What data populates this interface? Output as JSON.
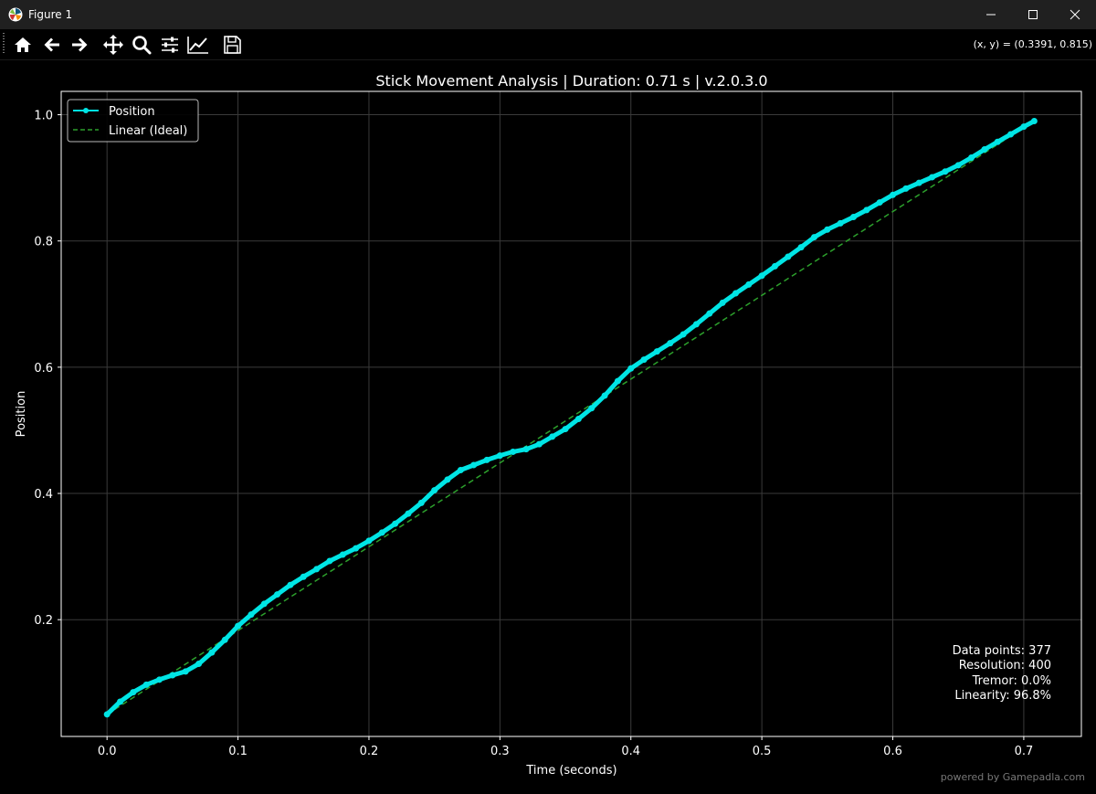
{
  "window": {
    "title": "Figure 1"
  },
  "toolbar": {
    "coords": "(x, y) = (0.3391, 0.815)",
    "tools": [
      "home-icon",
      "back-arrow-icon",
      "forward-arrow-icon",
      "pan-icon",
      "zoom-icon",
      "configure-subplots-icon",
      "edit-axis-icon",
      "save-icon"
    ]
  },
  "colors": {
    "background": "#000000",
    "series": "#00e5e5",
    "ideal": "#2ca02c",
    "grid": "#3a3a3a"
  },
  "stats": [
    "Data points: 377",
    "Resolution: 400",
    "Tremor: 0.0%",
    "Linearity: 96.8%"
  ],
  "watermark": "powered by Gamepadla.com",
  "chart_data": {
    "type": "line",
    "title": "Stick Movement Analysis | Duration: 0.71 s | v.2.0.3.0",
    "xlabel": "Time (seconds)",
    "ylabel": "Position",
    "xlim": [
      -0.035,
      0.744
    ],
    "ylim": [
      0.015,
      1.037
    ],
    "xticks": [
      0.0,
      0.1,
      0.2,
      0.3,
      0.4,
      0.5,
      0.6,
      0.7
    ],
    "xtick_labels": [
      "0.0",
      "0.1",
      "0.2",
      "0.3",
      "0.4",
      "0.5",
      "0.6",
      "0.7"
    ],
    "yticks": [
      0.2,
      0.4,
      0.6,
      0.8,
      1.0
    ],
    "ytick_labels": [
      "0.2",
      "0.4",
      "0.6",
      "0.8",
      "1.0"
    ],
    "grid": true,
    "legend_position": "top-left",
    "series": [
      {
        "name": "Position",
        "style": "solid-marker",
        "x": [
          0.0,
          0.01,
          0.02,
          0.03,
          0.04,
          0.05,
          0.06,
          0.07,
          0.08,
          0.09,
          0.1,
          0.11,
          0.12,
          0.13,
          0.14,
          0.15,
          0.16,
          0.17,
          0.18,
          0.19,
          0.2,
          0.21,
          0.22,
          0.23,
          0.24,
          0.25,
          0.26,
          0.27,
          0.28,
          0.29,
          0.3,
          0.31,
          0.32,
          0.33,
          0.34,
          0.35,
          0.36,
          0.37,
          0.38,
          0.39,
          0.4,
          0.41,
          0.42,
          0.43,
          0.44,
          0.45,
          0.46,
          0.47,
          0.48,
          0.49,
          0.5,
          0.51,
          0.52,
          0.53,
          0.54,
          0.55,
          0.56,
          0.57,
          0.58,
          0.59,
          0.6,
          0.61,
          0.62,
          0.63,
          0.64,
          0.65,
          0.66,
          0.67,
          0.68,
          0.69,
          0.7,
          0.708
        ],
        "y": [
          0.05,
          0.07,
          0.085,
          0.097,
          0.105,
          0.112,
          0.118,
          0.13,
          0.148,
          0.168,
          0.19,
          0.208,
          0.225,
          0.24,
          0.255,
          0.268,
          0.28,
          0.293,
          0.303,
          0.313,
          0.325,
          0.338,
          0.352,
          0.368,
          0.385,
          0.405,
          0.422,
          0.437,
          0.445,
          0.453,
          0.46,
          0.466,
          0.47,
          0.478,
          0.49,
          0.502,
          0.518,
          0.535,
          0.555,
          0.578,
          0.598,
          0.612,
          0.625,
          0.638,
          0.652,
          0.668,
          0.685,
          0.702,
          0.717,
          0.731,
          0.745,
          0.76,
          0.775,
          0.79,
          0.806,
          0.818,
          0.828,
          0.838,
          0.849,
          0.861,
          0.873,
          0.883,
          0.892,
          0.901,
          0.91,
          0.92,
          0.932,
          0.945,
          0.957,
          0.969,
          0.981,
          0.99
        ]
      },
      {
        "name": "Linear (Ideal)",
        "style": "dashed",
        "x": [
          0.0,
          0.708
        ],
        "y": [
          0.05,
          0.99
        ]
      }
    ]
  }
}
